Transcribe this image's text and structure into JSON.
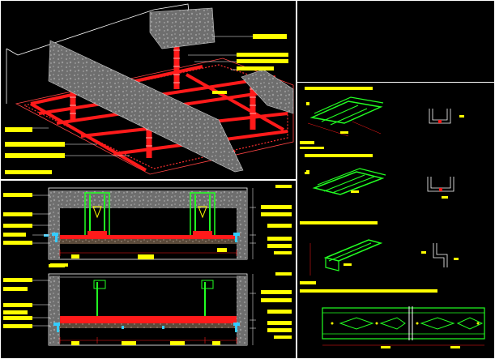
{
  "drawing": {
    "colors": {
      "background": "#000000",
      "frame": "#ffffff",
      "profile_red": "#ff1a1a",
      "profile_green": "#22ff22",
      "label_yellow": "#ffff00",
      "concrete_gray": "#8a8a8a",
      "fastener_cyan": "#33ccff"
    },
    "panels": [
      {
        "id": "isometric-view",
        "description": ""
      },
      {
        "id": "section-a",
        "description": ""
      },
      {
        "id": "section-b",
        "description": ""
      },
      {
        "id": "profile-details",
        "description": ""
      }
    ],
    "profiles": [
      {
        "name": "",
        "color": "green"
      },
      {
        "name": "",
        "color": "green"
      },
      {
        "name": "",
        "color": "green"
      },
      {
        "name": "",
        "color": "green"
      }
    ]
  }
}
